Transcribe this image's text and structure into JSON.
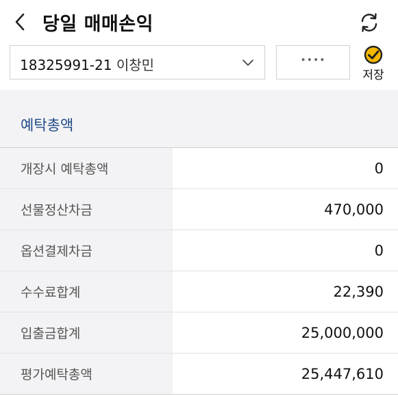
{
  "header": {
    "title": "당일 매매손익",
    "back_icon": "chevron-left-icon",
    "refresh_icon": "refresh-icon"
  },
  "account": {
    "number": "18325991-21",
    "name": "이창민",
    "password_mask": "••••",
    "save_label": "저장",
    "save_icon": "check-circle-icon"
  },
  "section": {
    "title": "예탁총액"
  },
  "rows": [
    {
      "label": "개장시 예탁총액",
      "value": "0"
    },
    {
      "label": "선물정산차금",
      "value": "470,000"
    },
    {
      "label": "옵션결제차금",
      "value": "0"
    },
    {
      "label": "수수료합계",
      "value": "22,390"
    },
    {
      "label": "입출금합계",
      "value": "25,000,000"
    },
    {
      "label": "평가예탁총액",
      "value": "25,447,610"
    }
  ],
  "colors": {
    "section_title": "#1e4a86",
    "label_bg": "#f3f3f5",
    "save_check_bg": "#f5b800"
  }
}
